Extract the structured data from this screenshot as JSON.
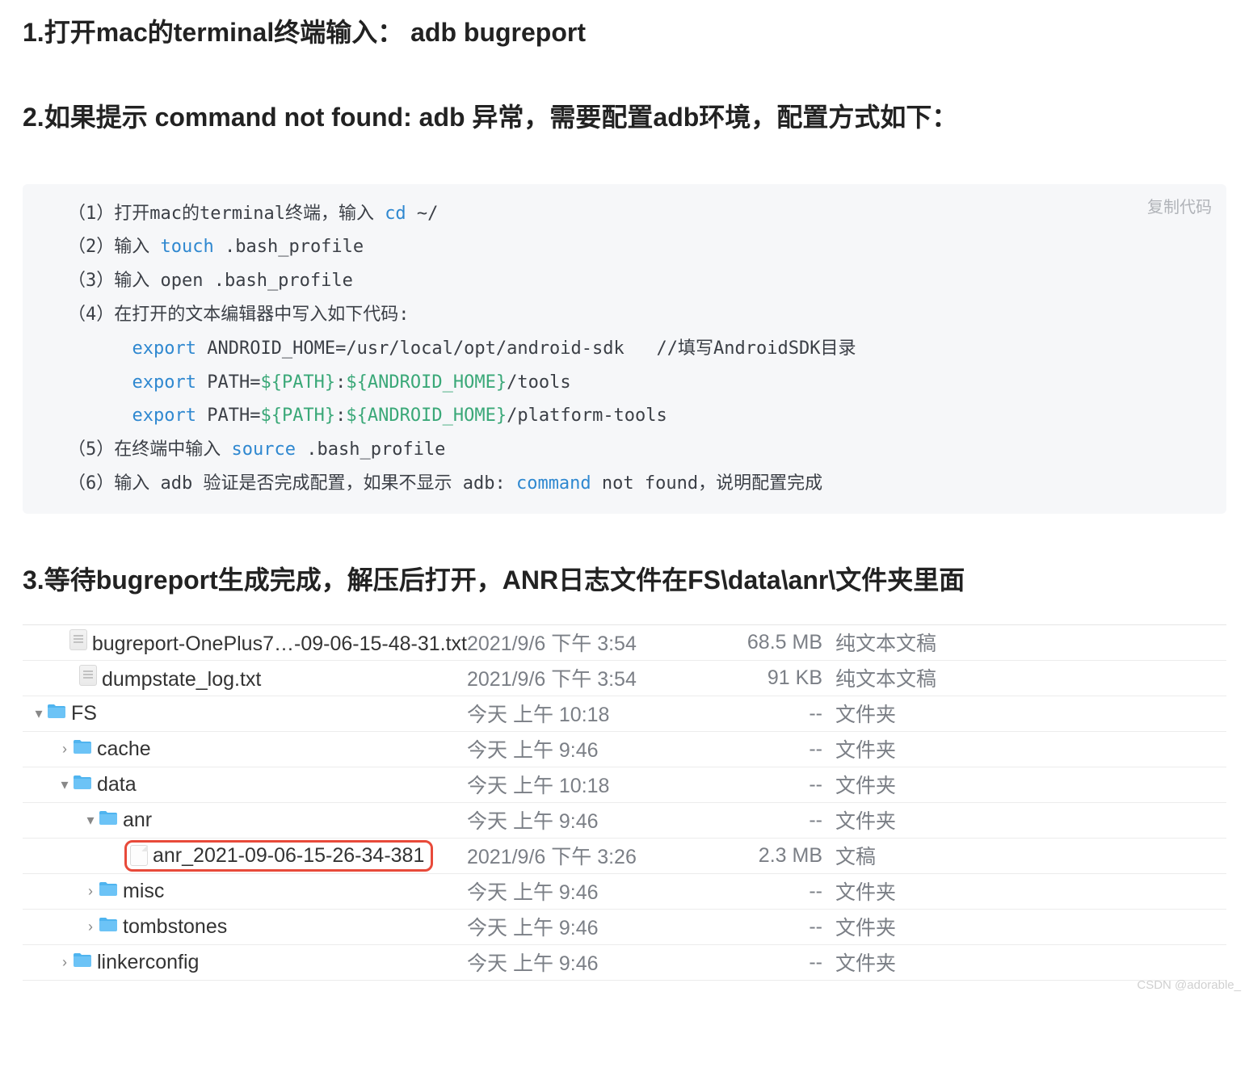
{
  "headings": {
    "h1": "1.打开mac的terminal终端输入： adb bugreport",
    "h2": "2.如果提示 command not found: adb 异常，需要配置adb环境，配置方式如下：",
    "h3": "3.等待bugreport生成完成，解压后打开，ANR日志文件在FS\\data\\anr\\文件夹里面"
  },
  "code": {
    "copy_label": "复制代码",
    "l1a": "（1）打开mac的terminal终端，输入 ",
    "l1_cmd": "cd",
    "l1b": " ~/",
    "l2a": "（2）输入 ",
    "l2_cmd": "touch",
    "l2b": " .bash_profile",
    "l3": "（3）输入 open .bash_profile",
    "l4": "（4）在打开的文本编辑器中写入如下代码:",
    "l5_kw": "export",
    "l5_rest": " ANDROID_HOME=/usr/local/opt/android-sdk   //填写AndroidSDK目录",
    "l6_kw": "export",
    "l6_mid": " PATH=",
    "l6_v1": "${PATH}",
    "l6_colon": ":",
    "l6_v2": "${ANDROID_HOME}",
    "l6_tail": "/tools",
    "l7_kw": "export",
    "l7_mid": " PATH=",
    "l7_v1": "${PATH}",
    "l7_colon": ":",
    "l7_v2": "${ANDROID_HOME}",
    "l7_tail": "/platform-tools",
    "l8a": "（5）在终端中输入 ",
    "l8_cmd": "source",
    "l8b": " .bash_profile",
    "l9a": "（6）输入 adb 验证是否完成配置，如果不显示 adb: ",
    "l9_cmd": "command",
    "l9b": " not found，说明配置完成"
  },
  "finder": {
    "rows": [
      {
        "indent": 50,
        "disclosure": "",
        "icon": "textdoc",
        "name": "bugreport-OnePlus7…-09-06-15-48-31.txt",
        "date": "2021/9/6 下午 3:54",
        "size": "68.5 MB",
        "kind": "纯文本文稿",
        "highlight": false
      },
      {
        "indent": 50,
        "disclosure": "",
        "icon": "textdoc",
        "name": "dumpstate_log.txt",
        "date": "2021/9/6 下午 3:54",
        "size": "91 KB",
        "kind": "纯文本文稿",
        "highlight": false
      },
      {
        "indent": 10,
        "disclosure": "v",
        "icon": "folder",
        "name": "FS",
        "date": "今天 上午 10:18",
        "size": "--",
        "kind": "文件夹",
        "highlight": false
      },
      {
        "indent": 42,
        "disclosure": ">",
        "icon": "folder",
        "name": "cache",
        "date": "今天 上午 9:46",
        "size": "--",
        "kind": "文件夹",
        "highlight": false
      },
      {
        "indent": 42,
        "disclosure": "v",
        "icon": "folder",
        "name": "data",
        "date": "今天 上午 10:18",
        "size": "--",
        "kind": "文件夹",
        "highlight": false
      },
      {
        "indent": 74,
        "disclosure": "v",
        "icon": "folder",
        "name": "anr",
        "date": "今天 上午 9:46",
        "size": "--",
        "kind": "文件夹",
        "highlight": false
      },
      {
        "indent": 110,
        "disclosure": "",
        "icon": "blankdoc",
        "name": "anr_2021-09-06-15-26-34-381",
        "date": "2021/9/6 下午 3:26",
        "size": "2.3 MB",
        "kind": "文稿",
        "highlight": true
      },
      {
        "indent": 74,
        "disclosure": ">",
        "icon": "folder",
        "name": "misc",
        "date": "今天 上午 9:46",
        "size": "--",
        "kind": "文件夹",
        "highlight": false
      },
      {
        "indent": 74,
        "disclosure": ">",
        "icon": "folder",
        "name": "tombstones",
        "date": "今天 上午 9:46",
        "size": "--",
        "kind": "文件夹",
        "highlight": false
      },
      {
        "indent": 42,
        "disclosure": ">",
        "icon": "folder",
        "name": "linkerconfig",
        "date": "今天 上午 9:46",
        "size": "--",
        "kind": "文件夹",
        "highlight": false
      }
    ]
  },
  "watermark": "CSDN @adorable_"
}
